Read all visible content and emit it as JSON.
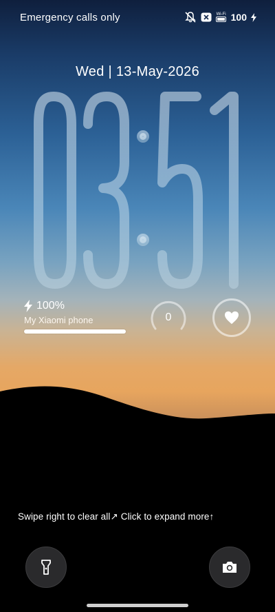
{
  "status_bar": {
    "carrier_text": "Emergency calls only",
    "wifi_label": "Wi-Fi",
    "battery_level": "100",
    "icons": [
      "mute-icon",
      "no-sim-icon",
      "wifi-icon",
      "charging-icon"
    ]
  },
  "lockscreen": {
    "date": "Wed | 13-May-2026",
    "time_hours": "03",
    "time_minutes": "51"
  },
  "widgets": {
    "battery_percent": "100%",
    "device_name": "My Xiaomi phone",
    "battery_fill": 1.0,
    "steps_value": "0"
  },
  "hint": {
    "text": "Swipe right to clear all↗ Click to expand more↑"
  },
  "colors": {
    "sky_top": "#0f1f3d",
    "horizon": "#e7a55e",
    "ground": "#000000"
  }
}
